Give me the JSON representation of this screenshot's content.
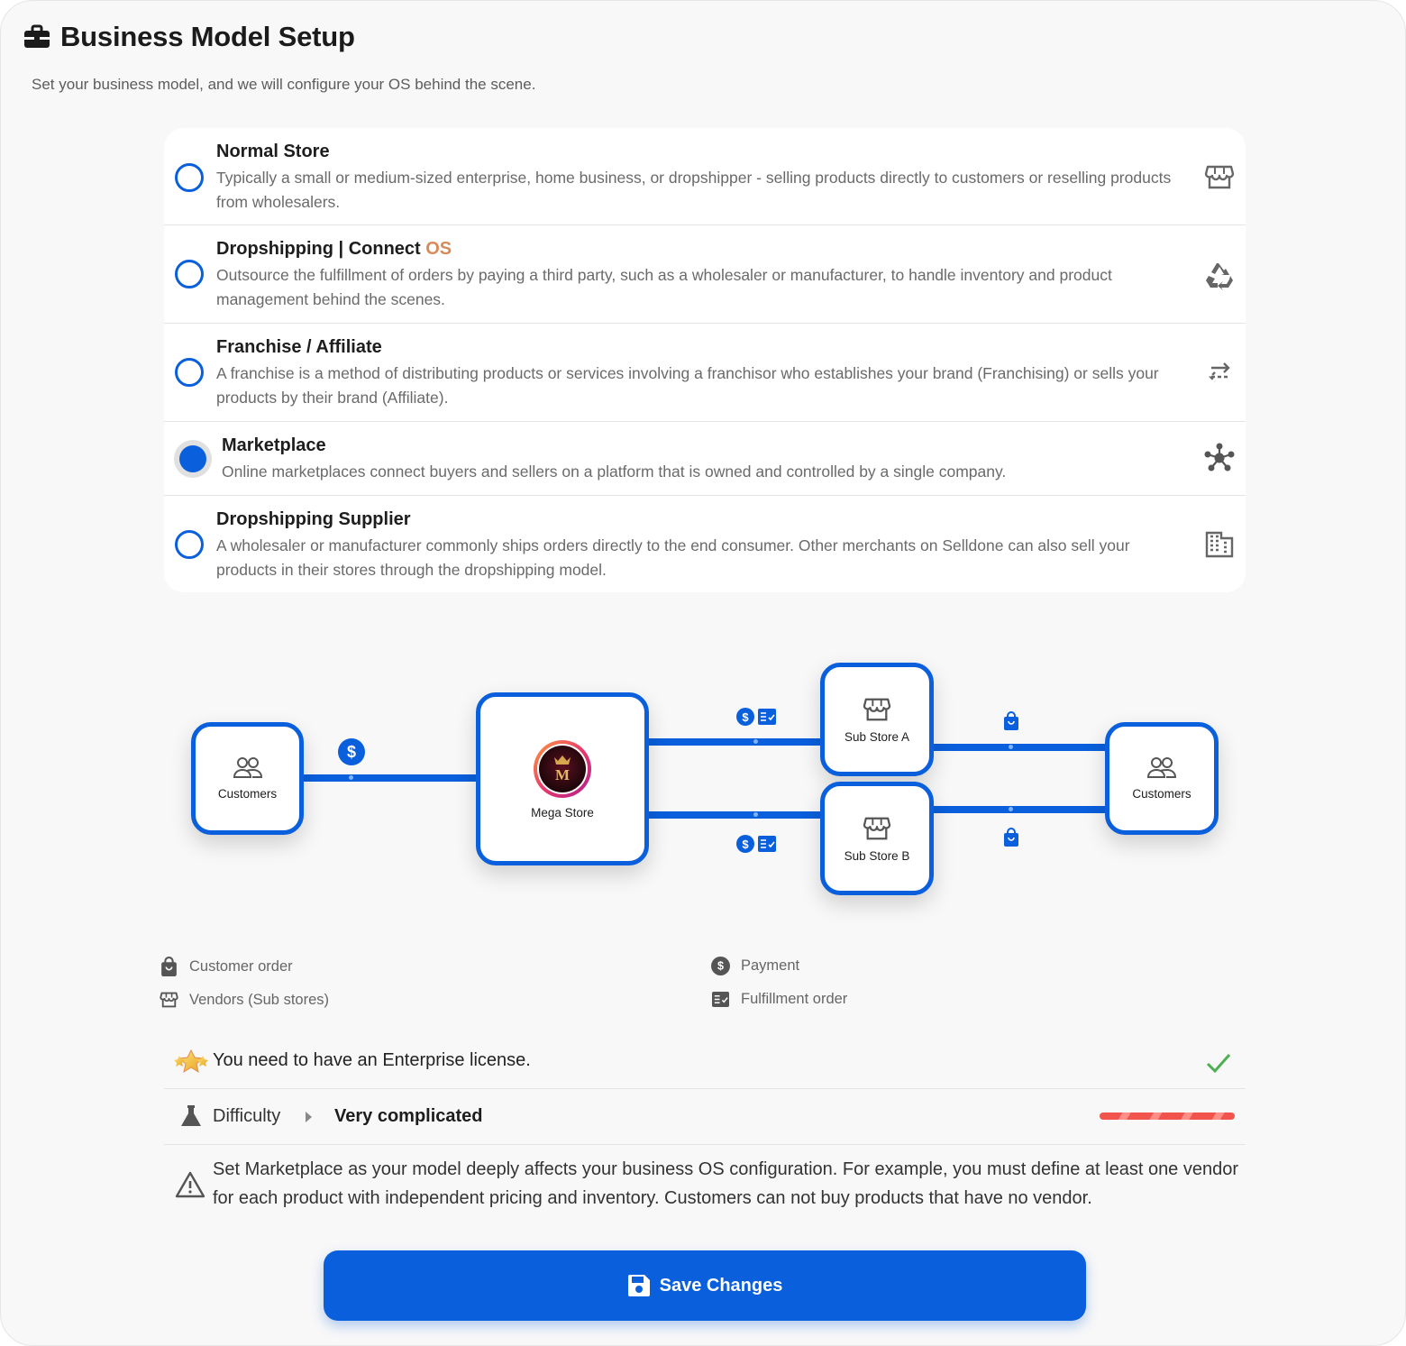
{
  "header": {
    "title": "Business Model Setup",
    "subtitle": "Set your business model, and we will configure your OS behind the scene.",
    "icon": "briefcase-icon"
  },
  "options": [
    {
      "title": "Normal Store",
      "description": "Typically a small or medium-sized enterprise, home business, or dropshipper - selling products directly to customers or reselling products from wholesalers.",
      "icon": "storefront-icon",
      "selected": false
    },
    {
      "title": "Dropshipping | Connect ",
      "title_suffix": "OS",
      "description": "Outsource the fulfillment of orders by paying a third party, such as a wholesaler or manufacturer, to handle inventory and product management behind the scenes.",
      "icon": "recycle-icon",
      "selected": false
    },
    {
      "title": "Franchise / Affiliate",
      "description": "A franchise is a method of distributing products or services involving a franchisor who establishes your brand (Franchising) or sells your products by their brand (Affiliate).",
      "icon": "swap-arrows-icon",
      "selected": false
    },
    {
      "title": "Marketplace",
      "description": "Online marketplaces connect buyers and sellers on a platform that is owned and controlled by a single company.",
      "icon": "hub-icon",
      "selected": true
    },
    {
      "title": "Dropshipping Supplier",
      "description": "A wholesaler or manufacturer commonly ships orders directly to the end consumer. Other merchants on Selldone can also sell your products in their stores through the dropshipping model.",
      "icon": "building-icon",
      "selected": false
    }
  ],
  "diagram": {
    "customers_left": "Customers",
    "mega_store": "Mega Store",
    "mega_store_logo_letter": "M",
    "sub_store_a": "Sub Store A",
    "sub_store_b": "Sub Store B",
    "customers_right": "Customers"
  },
  "legend": {
    "customer_order": "Customer order",
    "vendors": "Vendors (Sub stores)",
    "payment": "Payment",
    "fulfillment_order": "Fulfillment order"
  },
  "license": {
    "text": "You need to have an Enterprise license.",
    "status": "check"
  },
  "difficulty": {
    "label": "Difficulty",
    "value": "Very complicated",
    "level": 1.0,
    "color": "#f0544c"
  },
  "warning": {
    "text": "Set Marketplace as your model deeply affects your business OS configuration. For example, you must define at least one vendor for each product with independent pricing and inventory. Customers can not buy products that have no vendor."
  },
  "save_button": {
    "label": "Save Changes"
  },
  "colors": {
    "accent": "#0a5fdc",
    "success": "#4caf50",
    "os_accent": "#d88b5a"
  }
}
